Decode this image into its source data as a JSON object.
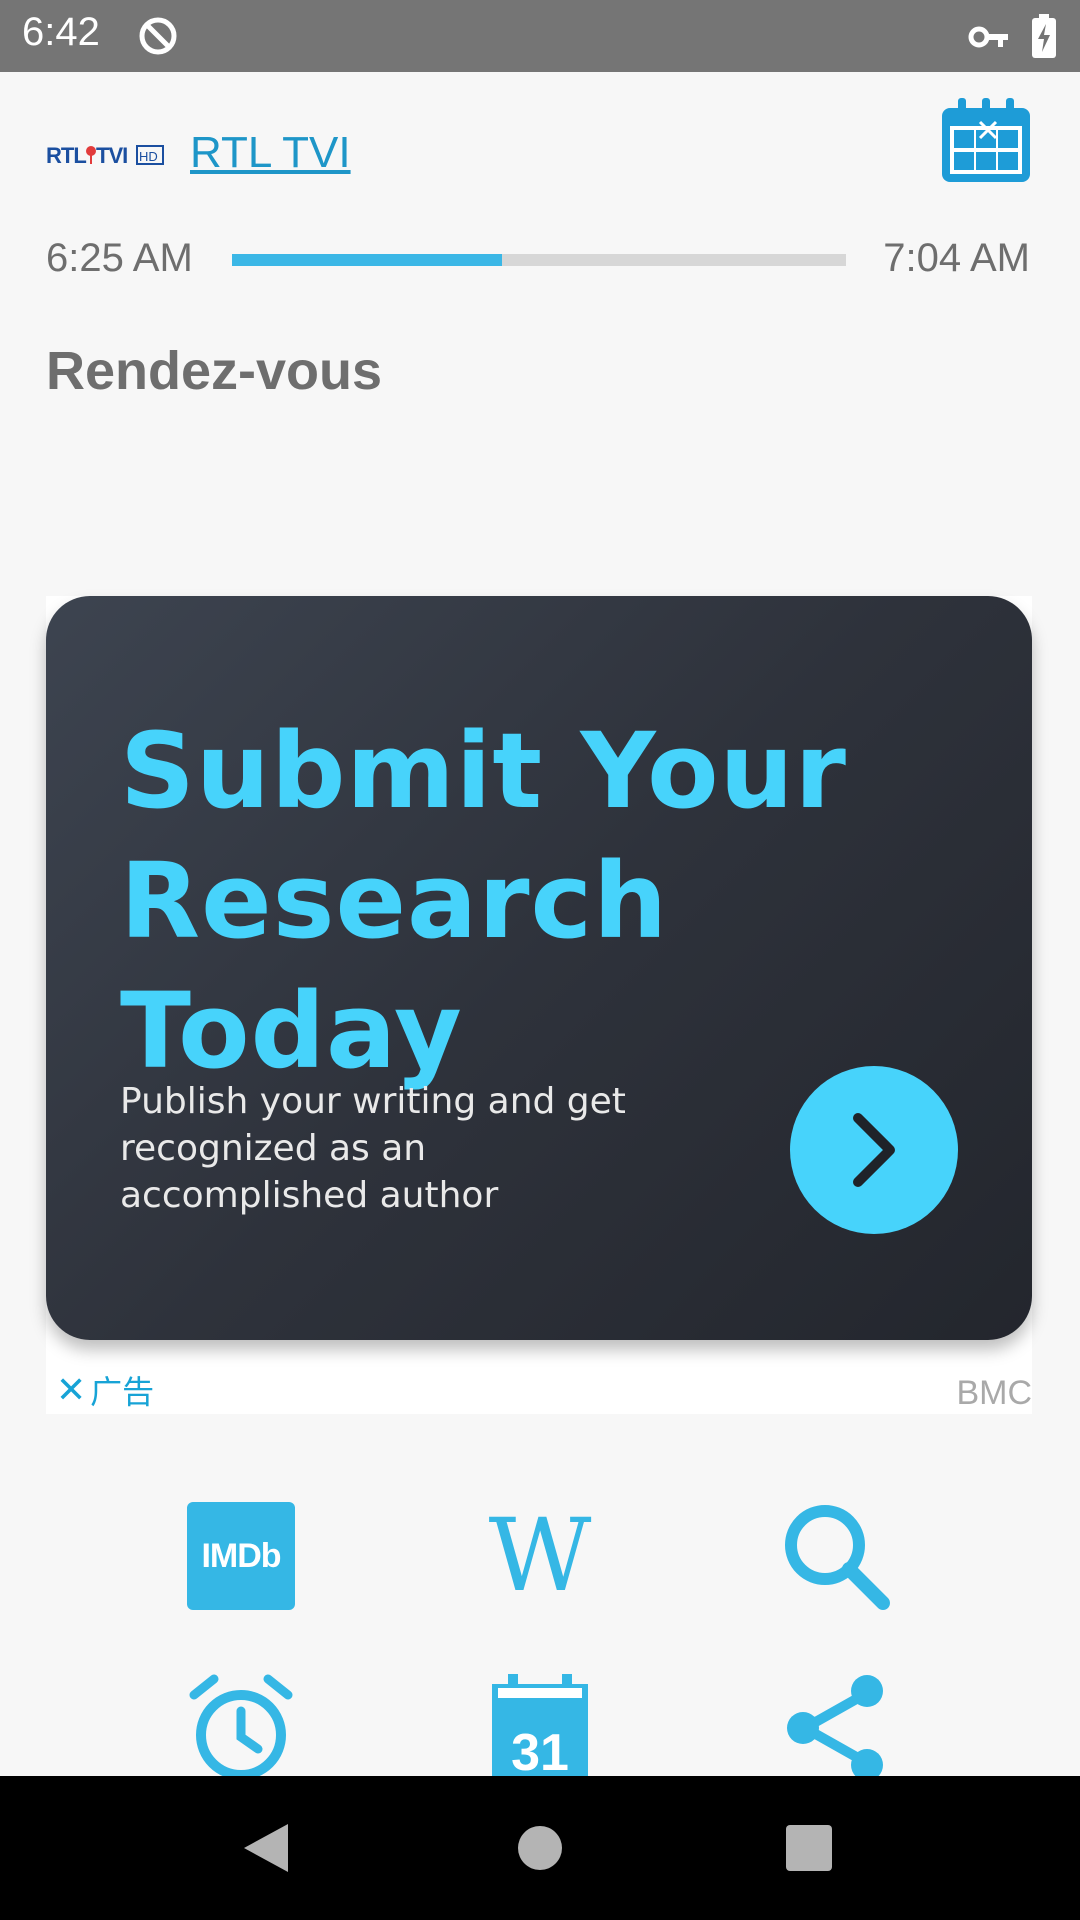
{
  "status_bar": {
    "time": "6:42",
    "icons": [
      "sync-disabled-icon",
      "vpn-key-icon",
      "battery-charging-icon"
    ]
  },
  "header": {
    "channel_logo_text": "RTL TVI HD",
    "channel_name": "RTL TVI",
    "calendar_icon": "calendar-grid-icon"
  },
  "program": {
    "start_time": "6:25 AM",
    "end_time": "7:04 AM",
    "progress_percent": 44,
    "title": "Rendez-vous"
  },
  "ad": {
    "headline": "Submit Your Research Today",
    "body": "Publish your writing and get recognized as an accomplished author",
    "cta_icon": "chevron-right-icon",
    "close_label": "广告",
    "advertiser": "BMC"
  },
  "actions": [
    {
      "name": "imdb",
      "label": "IMDb",
      "icon": "imdb-icon"
    },
    {
      "name": "wikipedia",
      "label": "W",
      "icon": "wikipedia-icon"
    },
    {
      "name": "search",
      "icon": "search-icon"
    },
    {
      "name": "alarm",
      "icon": "alarm-clock-icon"
    },
    {
      "name": "calendar",
      "label": "31",
      "icon": "calendar-icon"
    },
    {
      "name": "share",
      "icon": "share-icon"
    }
  ],
  "colors": {
    "accent": "#35b7e5",
    "ad_headline": "#47d3fb",
    "status_bar": "#757575"
  }
}
